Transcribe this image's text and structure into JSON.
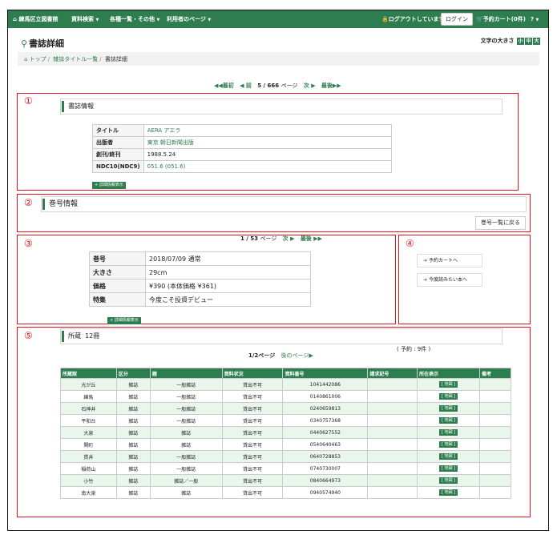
{
  "nav": {
    "home": "練馬区立図書館",
    "search": "資料検索",
    "lists": "各種一覧・その他",
    "user_page": "利用者のページ",
    "logout_status": "ログアウトしています",
    "login": "ログイン",
    "cart": "予約カート(0件)",
    "help": "?"
  },
  "page": {
    "title": "書誌詳細",
    "font_size_label": "文字の大きさ",
    "font_sizes": [
      "小",
      "中",
      "大"
    ]
  },
  "breadcrumb": [
    "トップ",
    "雑誌タイトル一覧",
    "書誌詳細"
  ],
  "record_pager": {
    "first": "最初",
    "prev": "前",
    "position": "5 / 666",
    "unit": "ページ",
    "next": "次",
    "last": "最後"
  },
  "markers": [
    "①",
    "②",
    "③",
    "④",
    "⑤"
  ],
  "bib_info": {
    "heading": "書誌情報",
    "rows": [
      {
        "label": "タイトル",
        "value": "AERA アエラ"
      },
      {
        "label": "出版者",
        "value": "東京 朝日新聞出版"
      },
      {
        "label": "創刊/終刊",
        "value": "1988.5.24"
      },
      {
        "label": "NDC10(NDC9)",
        "value": "051.6 (051.6)"
      }
    ],
    "detail_button": "+ 詳細情報表示"
  },
  "issue_info": {
    "heading": "巻号情報",
    "back_button": "巻号一覧に戻る"
  },
  "issue_detail": {
    "pager": {
      "position": "1 / 53",
      "unit": "ページ",
      "next": "次",
      "last": "最後"
    },
    "rows": [
      {
        "label": "巻号",
        "value": "2018/07/09 通常"
      },
      {
        "label": "大きさ",
        "value": "29cm"
      },
      {
        "label": "価格",
        "value": "¥390 (本体価格 ¥361)"
      },
      {
        "label": "特集",
        "value": "今度こそ投資デビュー"
      }
    ],
    "detail_button": "+ 詳細情報表示"
  },
  "actions": {
    "add_cart": "予約カートへ",
    "read_later": "今度読みたい本へ"
  },
  "holdings": {
    "heading_label": "所蔵",
    "count": "12冊",
    "reservations": "( 予約 : 9件 )",
    "pager_position": "1/2ページ",
    "next_page": "後のページ",
    "columns": [
      "所蔵館",
      "区分",
      "棚",
      "資料状況",
      "資料番号",
      "請求記号",
      "所在表示",
      "備考"
    ],
    "map_label": "[ 地図 ]",
    "rows": [
      {
        "library": "光が丘",
        "category": "雑誌",
        "shelf": "一般雑誌",
        "status": "貸出不可",
        "number": "1041442086"
      },
      {
        "library": "練馬",
        "category": "雑誌",
        "shelf": "一般雑誌",
        "status": "貸出不可",
        "number": "0140861006"
      },
      {
        "library": "石神井",
        "category": "雑誌",
        "shelf": "一般雑誌",
        "status": "貸出不可",
        "number": "0240659813"
      },
      {
        "library": "平和台",
        "category": "雑誌",
        "shelf": "一般雑誌",
        "status": "貸出不可",
        "number": "0340757368"
      },
      {
        "library": "大泉",
        "category": "雑誌",
        "shelf": "雑誌",
        "status": "貸出不可",
        "number": "0440627552"
      },
      {
        "library": "関町",
        "category": "雑誌",
        "shelf": "雑誌",
        "status": "貸出不可",
        "number": "0540640463"
      },
      {
        "library": "貫井",
        "category": "雑誌",
        "shelf": "一般雑誌",
        "status": "貸出不可",
        "number": "0640728853"
      },
      {
        "library": "稲荷山",
        "category": "雑誌",
        "shelf": "一般雑誌",
        "status": "貸出不可",
        "number": "0740730007"
      },
      {
        "library": "小竹",
        "category": "雑誌",
        "shelf": "雑誌／一般",
        "status": "貸出不可",
        "number": "0840664973"
      },
      {
        "library": "南大泉",
        "category": "雑誌",
        "shelf": "雑誌",
        "status": "貸出不可",
        "number": "0940574940"
      }
    ]
  },
  "colors": {
    "brand": "#2e7d4f",
    "marker": "#e0141e",
    "row_alt": "#e9f6ec"
  }
}
